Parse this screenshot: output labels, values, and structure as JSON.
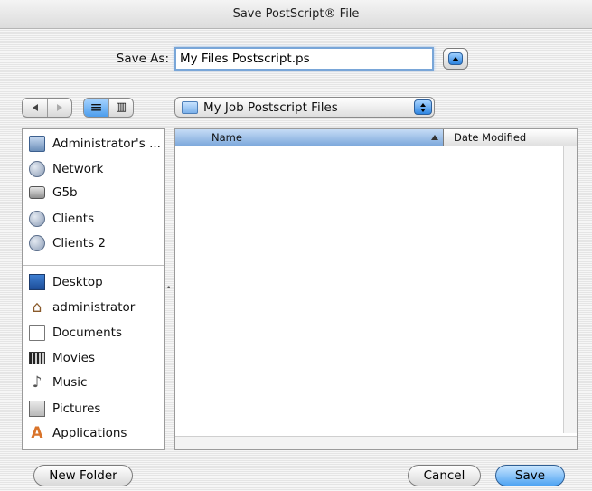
{
  "window": {
    "title": "Save PostScript® File"
  },
  "save_as": {
    "label": "Save As:",
    "value": "My Files Postscript.ps"
  },
  "location": {
    "folder": "My Job Postscript Files"
  },
  "sidebar": {
    "devices": [
      {
        "label": "Administrator's ...",
        "icon": "computer-icon"
      },
      {
        "label": "Network",
        "icon": "network-globe-icon"
      },
      {
        "label": "G5b",
        "icon": "hard-disk-icon"
      },
      {
        "label": "Clients",
        "icon": "network-volume-icon"
      },
      {
        "label": "Clients 2",
        "icon": "network-volume-icon"
      }
    ],
    "places": [
      {
        "label": "Desktop",
        "icon": "desktop-icon"
      },
      {
        "label": "administrator",
        "icon": "home-icon"
      },
      {
        "label": "Documents",
        "icon": "documents-icon"
      },
      {
        "label": "Movies",
        "icon": "movies-icon"
      },
      {
        "label": "Music",
        "icon": "music-icon"
      },
      {
        "label": "Pictures",
        "icon": "pictures-icon"
      },
      {
        "label": "Applications",
        "icon": "applications-icon"
      }
    ]
  },
  "columns": {
    "name": "Name",
    "date_modified": "Date Modified"
  },
  "buttons": {
    "new_folder": "New Folder",
    "cancel": "Cancel",
    "save": "Save"
  },
  "glyphs": {
    "list_view": "≡",
    "column_view": "▥",
    "home": "⌂",
    "music": "♪",
    "applications": "A"
  },
  "colors": {
    "accent": "#4fa3f2",
    "selection": "#7ea9dc"
  }
}
